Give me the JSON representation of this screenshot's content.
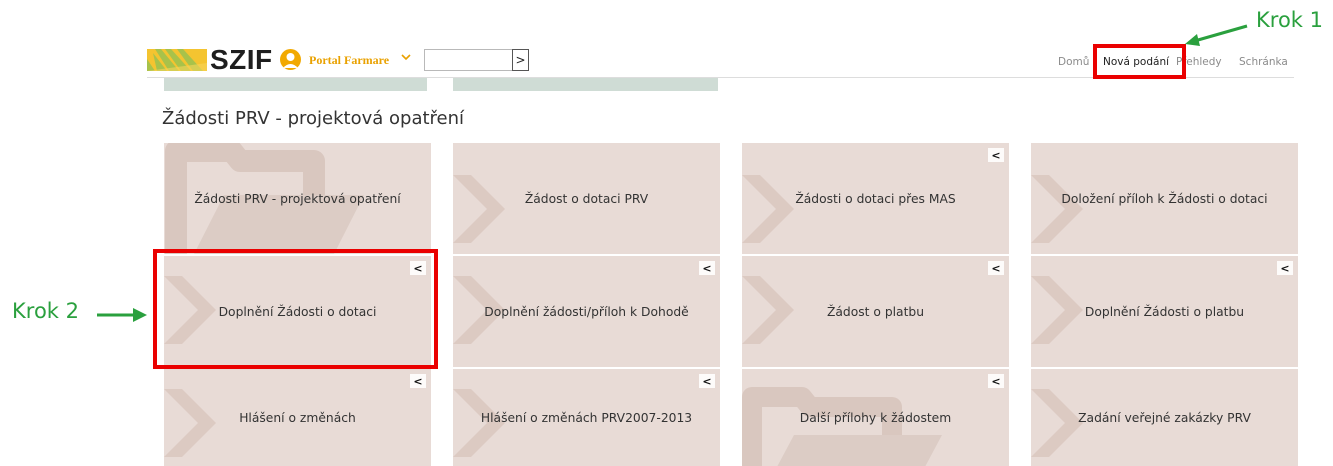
{
  "header": {
    "logo_text": "SZIF",
    "portal_label": "Portal Farmare",
    "search": {
      "value": "",
      "button_label": ">"
    },
    "nav": [
      "Domů",
      "Nová podání",
      "Přehledy",
      "Schránka"
    ]
  },
  "section_title": "Žádosti PRV - projektová opatření",
  "tiles": [
    [
      "Žádosti PRV - projektová opatření",
      "Žádost o dotaci PRV",
      "Žádosti o dotaci přes MAS",
      "Doložení příloh k Žádosti o dotaci"
    ],
    [
      "Doplnění Žádosti o dotaci",
      "Doplnění žádosti/příloh k Dohodě",
      "Žádost o platbu",
      "Doplnění Žádosti o platbu"
    ],
    [
      "Hlášení o změnách",
      "Hlášení o změnách PRV2007-2013",
      "Další přílohy k žádostem",
      "Zadání veřejné zakázky PRV"
    ]
  ],
  "collapse_label": "<",
  "annotations": {
    "step1": "Krok 1",
    "step2": "Krok 2"
  },
  "colors": {
    "tile_bg": "#e8dbd6",
    "highlight": "#ea0000",
    "annotation": "#2aa03e",
    "portal": "#f2a900"
  }
}
